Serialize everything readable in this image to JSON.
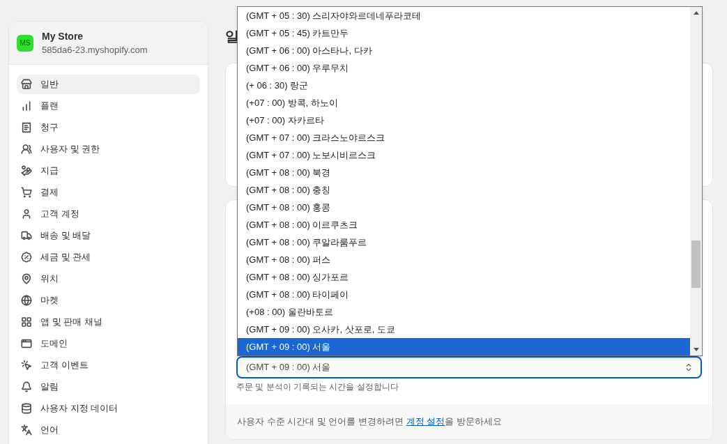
{
  "store": {
    "avatar": "MS",
    "name": "My Store",
    "domain": "585da6-23.myshopify.com"
  },
  "sidebar": {
    "items": [
      {
        "label": "일반",
        "selected": true
      },
      {
        "label": "플랜",
        "selected": false
      },
      {
        "label": "청구",
        "selected": false
      },
      {
        "label": "사용자 및 권한",
        "selected": false
      },
      {
        "label": "지급",
        "selected": false
      },
      {
        "label": "결제",
        "selected": false
      },
      {
        "label": "고객 계정",
        "selected": false
      },
      {
        "label": "배송 및 배달",
        "selected": false
      },
      {
        "label": "세금 및 관세",
        "selected": false
      },
      {
        "label": "위치",
        "selected": false
      },
      {
        "label": "마켓",
        "selected": false
      },
      {
        "label": "앱 및 판매 채널",
        "selected": false
      },
      {
        "label": "도메인",
        "selected": false
      },
      {
        "label": "고객 이벤트",
        "selected": false
      },
      {
        "label": "알림",
        "selected": false
      },
      {
        "label": "사용자 지정 데이터",
        "selected": false
      },
      {
        "label": "언어",
        "selected": false
      }
    ]
  },
  "page_title": "일",
  "timezone": {
    "options": [
      {
        "label": "(GMT + 05 : 30) 스리자야와르데네푸라코테",
        "selected": false
      },
      {
        "label": "(GMT + 05 : 45) 카트만두",
        "selected": false
      },
      {
        "label": "(GMT + 06 : 00) 아스타나, 다카",
        "selected": false
      },
      {
        "label": "(GMT + 06 : 00) 우루무치",
        "selected": false
      },
      {
        "label": "(+ 06 : 30) 랑군",
        "selected": false
      },
      {
        "label": "(+07 : 00) 방콕, 하노이",
        "selected": false
      },
      {
        "label": "(+07 : 00) 자카르타",
        "selected": false
      },
      {
        "label": "(GMT + 07 : 00) 크라스노야르스크",
        "selected": false
      },
      {
        "label": "(GMT + 07 : 00) 노보시비르스크",
        "selected": false
      },
      {
        "label": "(GMT + 08 : 00) 북경",
        "selected": false
      },
      {
        "label": "(GMT + 08 : 00) 충칭",
        "selected": false
      },
      {
        "label": "(GMT + 08 : 00) 홍콩",
        "selected": false
      },
      {
        "label": "(GMT + 08 : 00) 이르쿠츠크",
        "selected": false
      },
      {
        "label": "(GMT + 08 : 00) 쿠알라룸푸르",
        "selected": false
      },
      {
        "label": "(GMT + 08 : 00) 퍼스",
        "selected": false
      },
      {
        "label": "(GMT + 08 : 00) 싱가포르",
        "selected": false
      },
      {
        "label": "(GMT + 08 : 00) 타이페이",
        "selected": false
      },
      {
        "label": "(+08 : 00) 울란바토르",
        "selected": false
      },
      {
        "label": "(GMT + 09 : 00) 오사카, 삿포로, 도쿄",
        "selected": false
      },
      {
        "label": "(GMT + 09 : 00) 서울",
        "selected": true
      }
    ],
    "value": "(GMT + 09 : 00) 서울",
    "helper": "주문 및 분석이 기록되는 시간을 설정합니다"
  },
  "footer_note": {
    "before": "사용자 수준 시간대 및 언어를 변경하려면 ",
    "link": "계정 설정",
    "after": "을 방문하세요"
  }
}
